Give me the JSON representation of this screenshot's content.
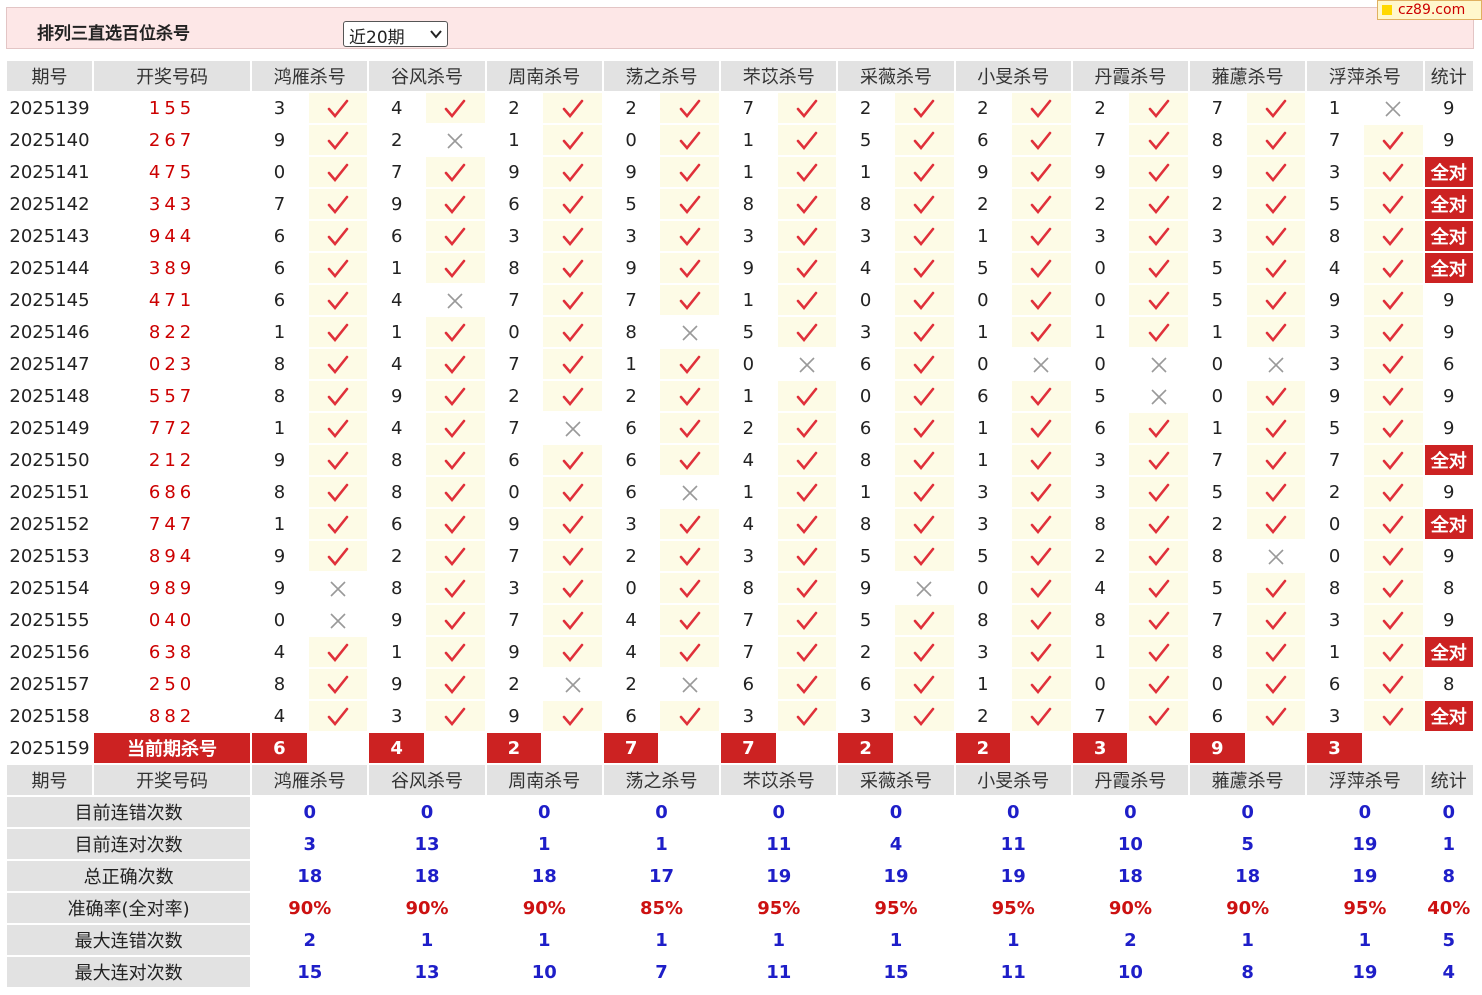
{
  "header": {
    "title": "排列三直选百位杀号",
    "period_select": "近20期"
  },
  "watermark": {
    "text": "cz89.com"
  },
  "columns": {
    "issue": "期号",
    "draw": "开奖号码",
    "stat": "统计",
    "experts": [
      "鸿雁杀号",
      "谷风杀号",
      "周南杀号",
      "荡之杀号",
      "芣苡杀号",
      "采薇杀号",
      "小旻杀号",
      "丹霞杀号",
      "蕥藘杀号",
      "浮萍杀号"
    ]
  },
  "icons": {
    "hit": "check-icon",
    "miss": "cross-icon"
  },
  "colors": {
    "accent": "#cc2222",
    "hit": "#e0303a",
    "miss": "#999999",
    "stat_value": "#1e1ec8"
  },
  "rows": [
    {
      "issue": "2025139",
      "draw": "155",
      "kills": [
        3,
        4,
        2,
        2,
        7,
        2,
        2,
        2,
        7,
        1
      ],
      "hits": [
        1,
        1,
        1,
        1,
        1,
        1,
        1,
        1,
        1,
        0
      ],
      "stat": "9"
    },
    {
      "issue": "2025140",
      "draw": "267",
      "kills": [
        9,
        2,
        1,
        0,
        1,
        5,
        6,
        7,
        8,
        7
      ],
      "hits": [
        1,
        0,
        1,
        1,
        1,
        1,
        1,
        1,
        1,
        1
      ],
      "stat": "9"
    },
    {
      "issue": "2025141",
      "draw": "475",
      "kills": [
        0,
        7,
        9,
        9,
        1,
        1,
        9,
        9,
        9,
        3
      ],
      "hits": [
        1,
        1,
        1,
        1,
        1,
        1,
        1,
        1,
        1,
        1
      ],
      "stat": "全对"
    },
    {
      "issue": "2025142",
      "draw": "343",
      "kills": [
        7,
        9,
        6,
        5,
        8,
        8,
        2,
        2,
        2,
        5
      ],
      "hits": [
        1,
        1,
        1,
        1,
        1,
        1,
        1,
        1,
        1,
        1
      ],
      "stat": "全对"
    },
    {
      "issue": "2025143",
      "draw": "944",
      "kills": [
        6,
        6,
        3,
        3,
        3,
        3,
        1,
        3,
        3,
        8
      ],
      "hits": [
        1,
        1,
        1,
        1,
        1,
        1,
        1,
        1,
        1,
        1
      ],
      "stat": "全对"
    },
    {
      "issue": "2025144",
      "draw": "389",
      "kills": [
        6,
        1,
        8,
        9,
        9,
        4,
        5,
        0,
        5,
        4
      ],
      "hits": [
        1,
        1,
        1,
        1,
        1,
        1,
        1,
        1,
        1,
        1
      ],
      "stat": "全对"
    },
    {
      "issue": "2025145",
      "draw": "471",
      "kills": [
        6,
        4,
        7,
        7,
        1,
        0,
        0,
        0,
        5,
        9
      ],
      "hits": [
        1,
        0,
        1,
        1,
        1,
        1,
        1,
        1,
        1,
        1
      ],
      "stat": "9"
    },
    {
      "issue": "2025146",
      "draw": "822",
      "kills": [
        1,
        1,
        0,
        8,
        5,
        3,
        1,
        1,
        1,
        3
      ],
      "hits": [
        1,
        1,
        1,
        0,
        1,
        1,
        1,
        1,
        1,
        1
      ],
      "stat": "9"
    },
    {
      "issue": "2025147",
      "draw": "023",
      "kills": [
        8,
        4,
        7,
        1,
        0,
        6,
        0,
        0,
        0,
        3
      ],
      "hits": [
        1,
        1,
        1,
        1,
        0,
        1,
        0,
        0,
        0,
        1
      ],
      "stat": "6"
    },
    {
      "issue": "2025148",
      "draw": "557",
      "kills": [
        8,
        9,
        2,
        2,
        1,
        0,
        6,
        5,
        0,
        9
      ],
      "hits": [
        1,
        1,
        1,
        1,
        1,
        1,
        1,
        0,
        1,
        1
      ],
      "stat": "9"
    },
    {
      "issue": "2025149",
      "draw": "772",
      "kills": [
        1,
        4,
        7,
        6,
        2,
        6,
        1,
        6,
        1,
        5
      ],
      "hits": [
        1,
        1,
        0,
        1,
        1,
        1,
        1,
        1,
        1,
        1
      ],
      "stat": "9"
    },
    {
      "issue": "2025150",
      "draw": "212",
      "kills": [
        9,
        8,
        6,
        6,
        4,
        8,
        1,
        3,
        7,
        7
      ],
      "hits": [
        1,
        1,
        1,
        1,
        1,
        1,
        1,
        1,
        1,
        1
      ],
      "stat": "全对"
    },
    {
      "issue": "2025151",
      "draw": "686",
      "kills": [
        8,
        8,
        0,
        6,
        1,
        1,
        3,
        3,
        5,
        2
      ],
      "hits": [
        1,
        1,
        1,
        0,
        1,
        1,
        1,
        1,
        1,
        1
      ],
      "stat": "9"
    },
    {
      "issue": "2025152",
      "draw": "747",
      "kills": [
        1,
        6,
        9,
        3,
        4,
        8,
        3,
        8,
        2,
        0
      ],
      "hits": [
        1,
        1,
        1,
        1,
        1,
        1,
        1,
        1,
        1,
        1
      ],
      "stat": "全对"
    },
    {
      "issue": "2025153",
      "draw": "894",
      "kills": [
        9,
        2,
        7,
        2,
        3,
        5,
        5,
        2,
        8,
        0
      ],
      "hits": [
        1,
        1,
        1,
        1,
        1,
        1,
        1,
        1,
        0,
        1
      ],
      "stat": "9"
    },
    {
      "issue": "2025154",
      "draw": "989",
      "kills": [
        9,
        8,
        3,
        0,
        8,
        9,
        0,
        4,
        5,
        8
      ],
      "hits": [
        0,
        1,
        1,
        1,
        1,
        0,
        1,
        1,
        1,
        1
      ],
      "stat": "8"
    },
    {
      "issue": "2025155",
      "draw": "040",
      "kills": [
        0,
        9,
        7,
        4,
        7,
        5,
        8,
        8,
        7,
        3
      ],
      "hits": [
        0,
        1,
        1,
        1,
        1,
        1,
        1,
        1,
        1,
        1
      ],
      "stat": "9"
    },
    {
      "issue": "2025156",
      "draw": "638",
      "kills": [
        4,
        1,
        9,
        4,
        7,
        2,
        3,
        1,
        8,
        1
      ],
      "hits": [
        1,
        1,
        1,
        1,
        1,
        1,
        1,
        1,
        1,
        1
      ],
      "stat": "全对"
    },
    {
      "issue": "2025157",
      "draw": "250",
      "kills": [
        8,
        9,
        2,
        2,
        6,
        6,
        1,
        0,
        0,
        6
      ],
      "hits": [
        1,
        1,
        0,
        0,
        1,
        1,
        1,
        1,
        1,
        1
      ],
      "stat": "8"
    },
    {
      "issue": "2025158",
      "draw": "882",
      "kills": [
        4,
        3,
        9,
        6,
        3,
        3,
        2,
        7,
        6,
        3
      ],
      "hits": [
        1,
        1,
        1,
        1,
        1,
        1,
        1,
        1,
        1,
        1
      ],
      "stat": "全对"
    }
  ],
  "current": {
    "issue": "2025159",
    "label": "当前期杀号",
    "kills": [
      6,
      4,
      2,
      7,
      7,
      2,
      2,
      3,
      9,
      3
    ]
  },
  "stats": [
    {
      "label": "目前连错次数",
      "values": [
        "0",
        "0",
        "0",
        "0",
        "0",
        "0",
        "0",
        "0",
        "0",
        "0"
      ],
      "total": "0",
      "rate": false
    },
    {
      "label": "目前连对次数",
      "values": [
        "3",
        "13",
        "1",
        "1",
        "11",
        "4",
        "11",
        "10",
        "5",
        "19"
      ],
      "total": "1",
      "rate": false
    },
    {
      "label": "总正确次数",
      "values": [
        "18",
        "18",
        "18",
        "17",
        "19",
        "19",
        "19",
        "18",
        "18",
        "19"
      ],
      "total": "8",
      "rate": false
    },
    {
      "label": "准确率(全对率)",
      "values": [
        "90%",
        "90%",
        "90%",
        "85%",
        "95%",
        "95%",
        "95%",
        "90%",
        "90%",
        "95%"
      ],
      "total": "40%",
      "rate": true
    },
    {
      "label": "最大连错次数",
      "values": [
        "2",
        "1",
        "1",
        "1",
        "1",
        "1",
        "1",
        "2",
        "1",
        "1"
      ],
      "total": "5",
      "rate": false
    },
    {
      "label": "最大连对次数",
      "values": [
        "15",
        "13",
        "10",
        "7",
        "11",
        "15",
        "11",
        "10",
        "8",
        "19"
      ],
      "total": "4",
      "rate": false
    }
  ]
}
